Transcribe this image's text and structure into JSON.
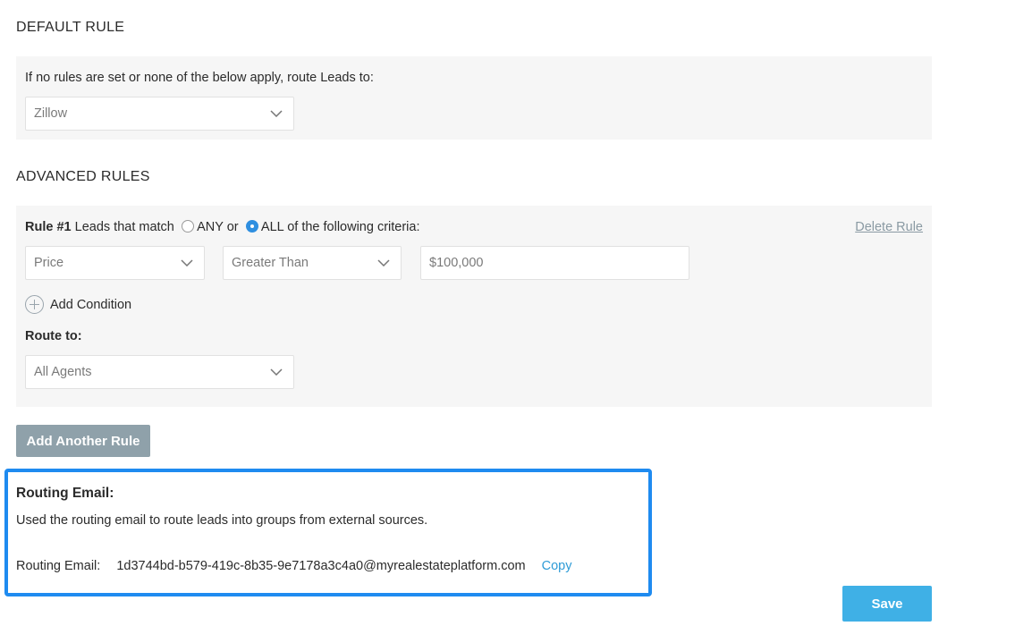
{
  "default_rule": {
    "section_title": "DEFAULT RULE",
    "description": "If no rules are set or none of the below apply, route Leads to:",
    "route_select": "Zillow"
  },
  "advanced_rules": {
    "section_title": "ADVANCED RULES",
    "rule": {
      "number": "Rule #1",
      "match_text": "Leads that match",
      "any_label": "ANY",
      "or_text": "or",
      "all_label": "ALL of the following criteria:",
      "selected_match": "ALL",
      "delete_label": "Delete Rule",
      "condition": {
        "field": "Price",
        "operator": "Greater Than",
        "value": "$100,000"
      },
      "add_condition_label": "Add Condition",
      "route_to_label": "Route to:",
      "route_to_select": "All Agents"
    },
    "add_rule_button": "Add Another Rule"
  },
  "routing_email": {
    "heading": "Routing Email:",
    "description": "Used the routing email to route leads into groups from external sources.",
    "label": "Routing Email:",
    "address": "1d3744bd-b579-419c-8b35-9e7178a3c4a0@myrealestateplatform.com",
    "copy_label": "Copy"
  },
  "save_button": "Save",
  "colors": {
    "highlight": "#1f8bf0",
    "save_button": "#3fb0e6",
    "add_rule_button": "#8fa1aa",
    "link": "#2e9bd6",
    "radio_selected": "#2f8fe0"
  }
}
